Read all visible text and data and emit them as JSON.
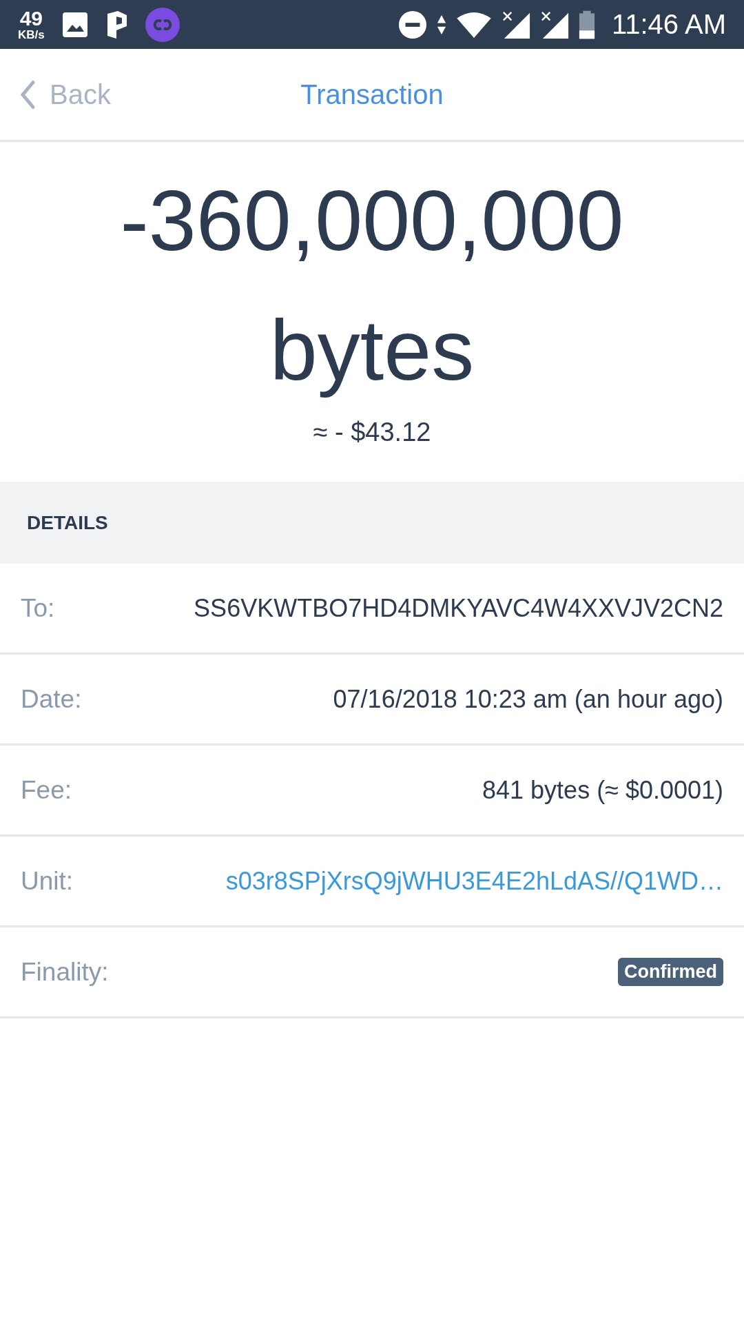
{
  "status_bar": {
    "speed": "49",
    "speed_unit": "KB/s",
    "time": "11:46 AM"
  },
  "nav": {
    "back": "Back",
    "title": "Transaction"
  },
  "amount": {
    "value": "-360,000,000",
    "unit": "bytes",
    "fiat": "≈ - $43.12"
  },
  "details": {
    "heading": "DETAILS",
    "rows": [
      {
        "label": "To:",
        "value": "SS6VKWTBO7HD4DMKYAVC4W4XXVJV2CN2",
        "kind": "text"
      },
      {
        "label": "Date:",
        "value": "07/16/2018 10:23 am (an hour ago)",
        "kind": "text"
      },
      {
        "label": "Fee:",
        "value": "841 bytes (≈ $0.0001)",
        "kind": "text"
      },
      {
        "label": "Unit:",
        "value": "s03r8SPjXrsQ9jWHU3E4E2hLdAS//Q1WD…",
        "kind": "link"
      },
      {
        "label": "Finality:",
        "value": "Confirmed",
        "kind": "badge"
      }
    ]
  }
}
